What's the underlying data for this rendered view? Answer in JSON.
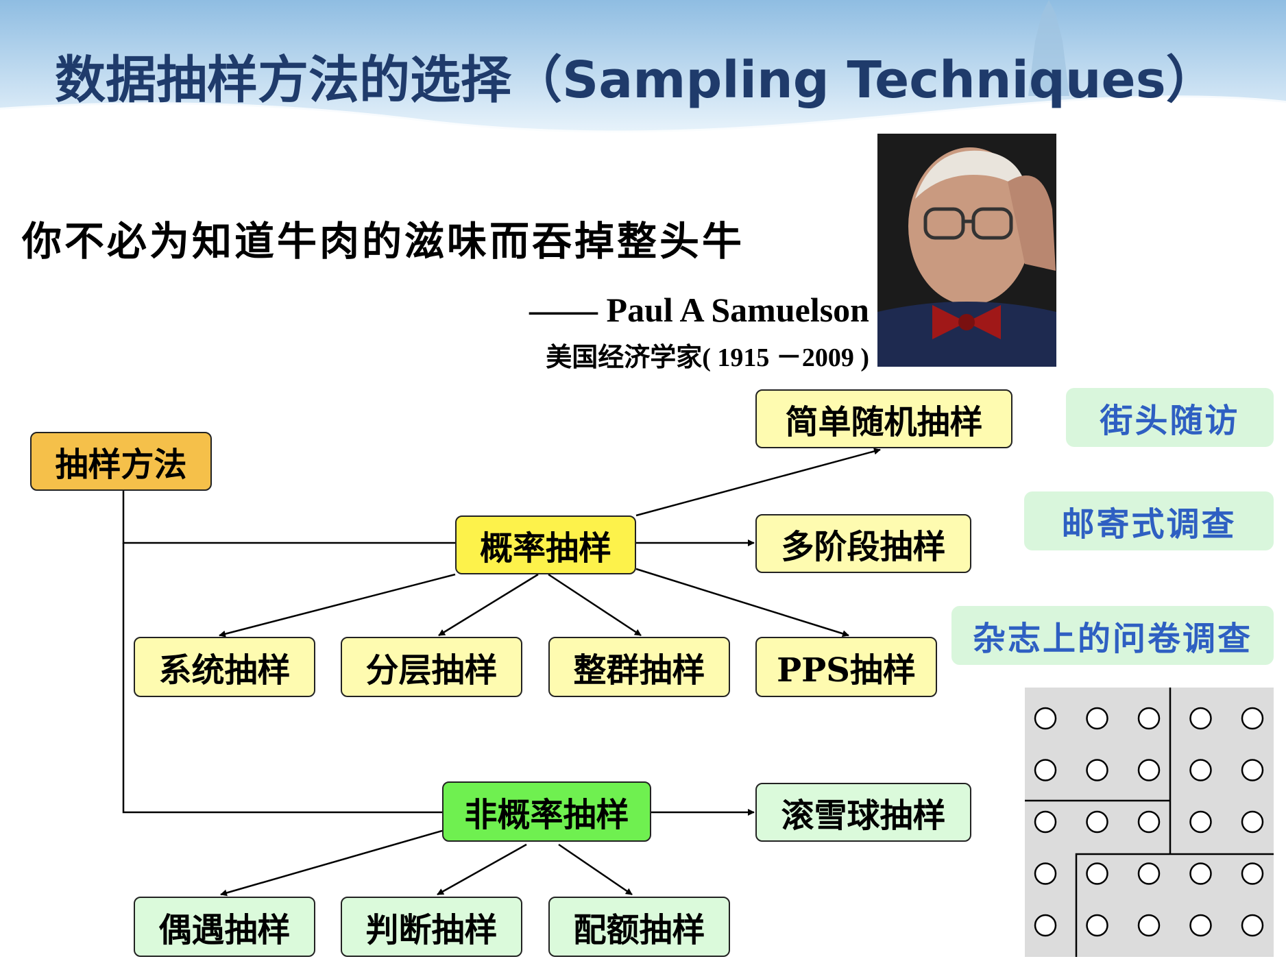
{
  "title": "数据抽样方法的选择（Sampling Techniques）",
  "quote": {
    "text": "你不必为知道牛肉的滋味而吞掉整头牛",
    "author": "—— Paul A Samuelson",
    "author_desc": "美国经济学家( 1915 －2009 )"
  },
  "diagram": {
    "root": "抽样方法",
    "probability": "概率抽样",
    "probability_methods": {
      "simple_random": "简单随机抽样",
      "multi_stage": "多阶段抽样",
      "systematic": "系统抽样",
      "stratified": "分层抽样",
      "cluster": "整群抽样",
      "pps": "PPS抽样"
    },
    "non_probability": "非概率抽样",
    "non_probability_methods": {
      "snowball": "滚雪球抽样",
      "convenience": "偶遇抽样",
      "judgment": "判断抽样",
      "quota": "配额抽样"
    }
  },
  "examples": [
    "街头随访",
    "邮寄式调查",
    "杂志上的问卷调查"
  ],
  "colors": {
    "title": "#1f3b6b",
    "root_fill": "#f5c04a",
    "probability_fill": "#fdf24b",
    "probability_child_fill": "#fefbb0",
    "non_probability_fill": "#6ff050",
    "non_probability_child_fill": "#dbfadb",
    "example_text": "#2e5fc2",
    "example_fill": "#d9f6dc"
  },
  "figure": {
    "type": "cluster-sampling-grid",
    "rows": 5,
    "cols": 5
  }
}
